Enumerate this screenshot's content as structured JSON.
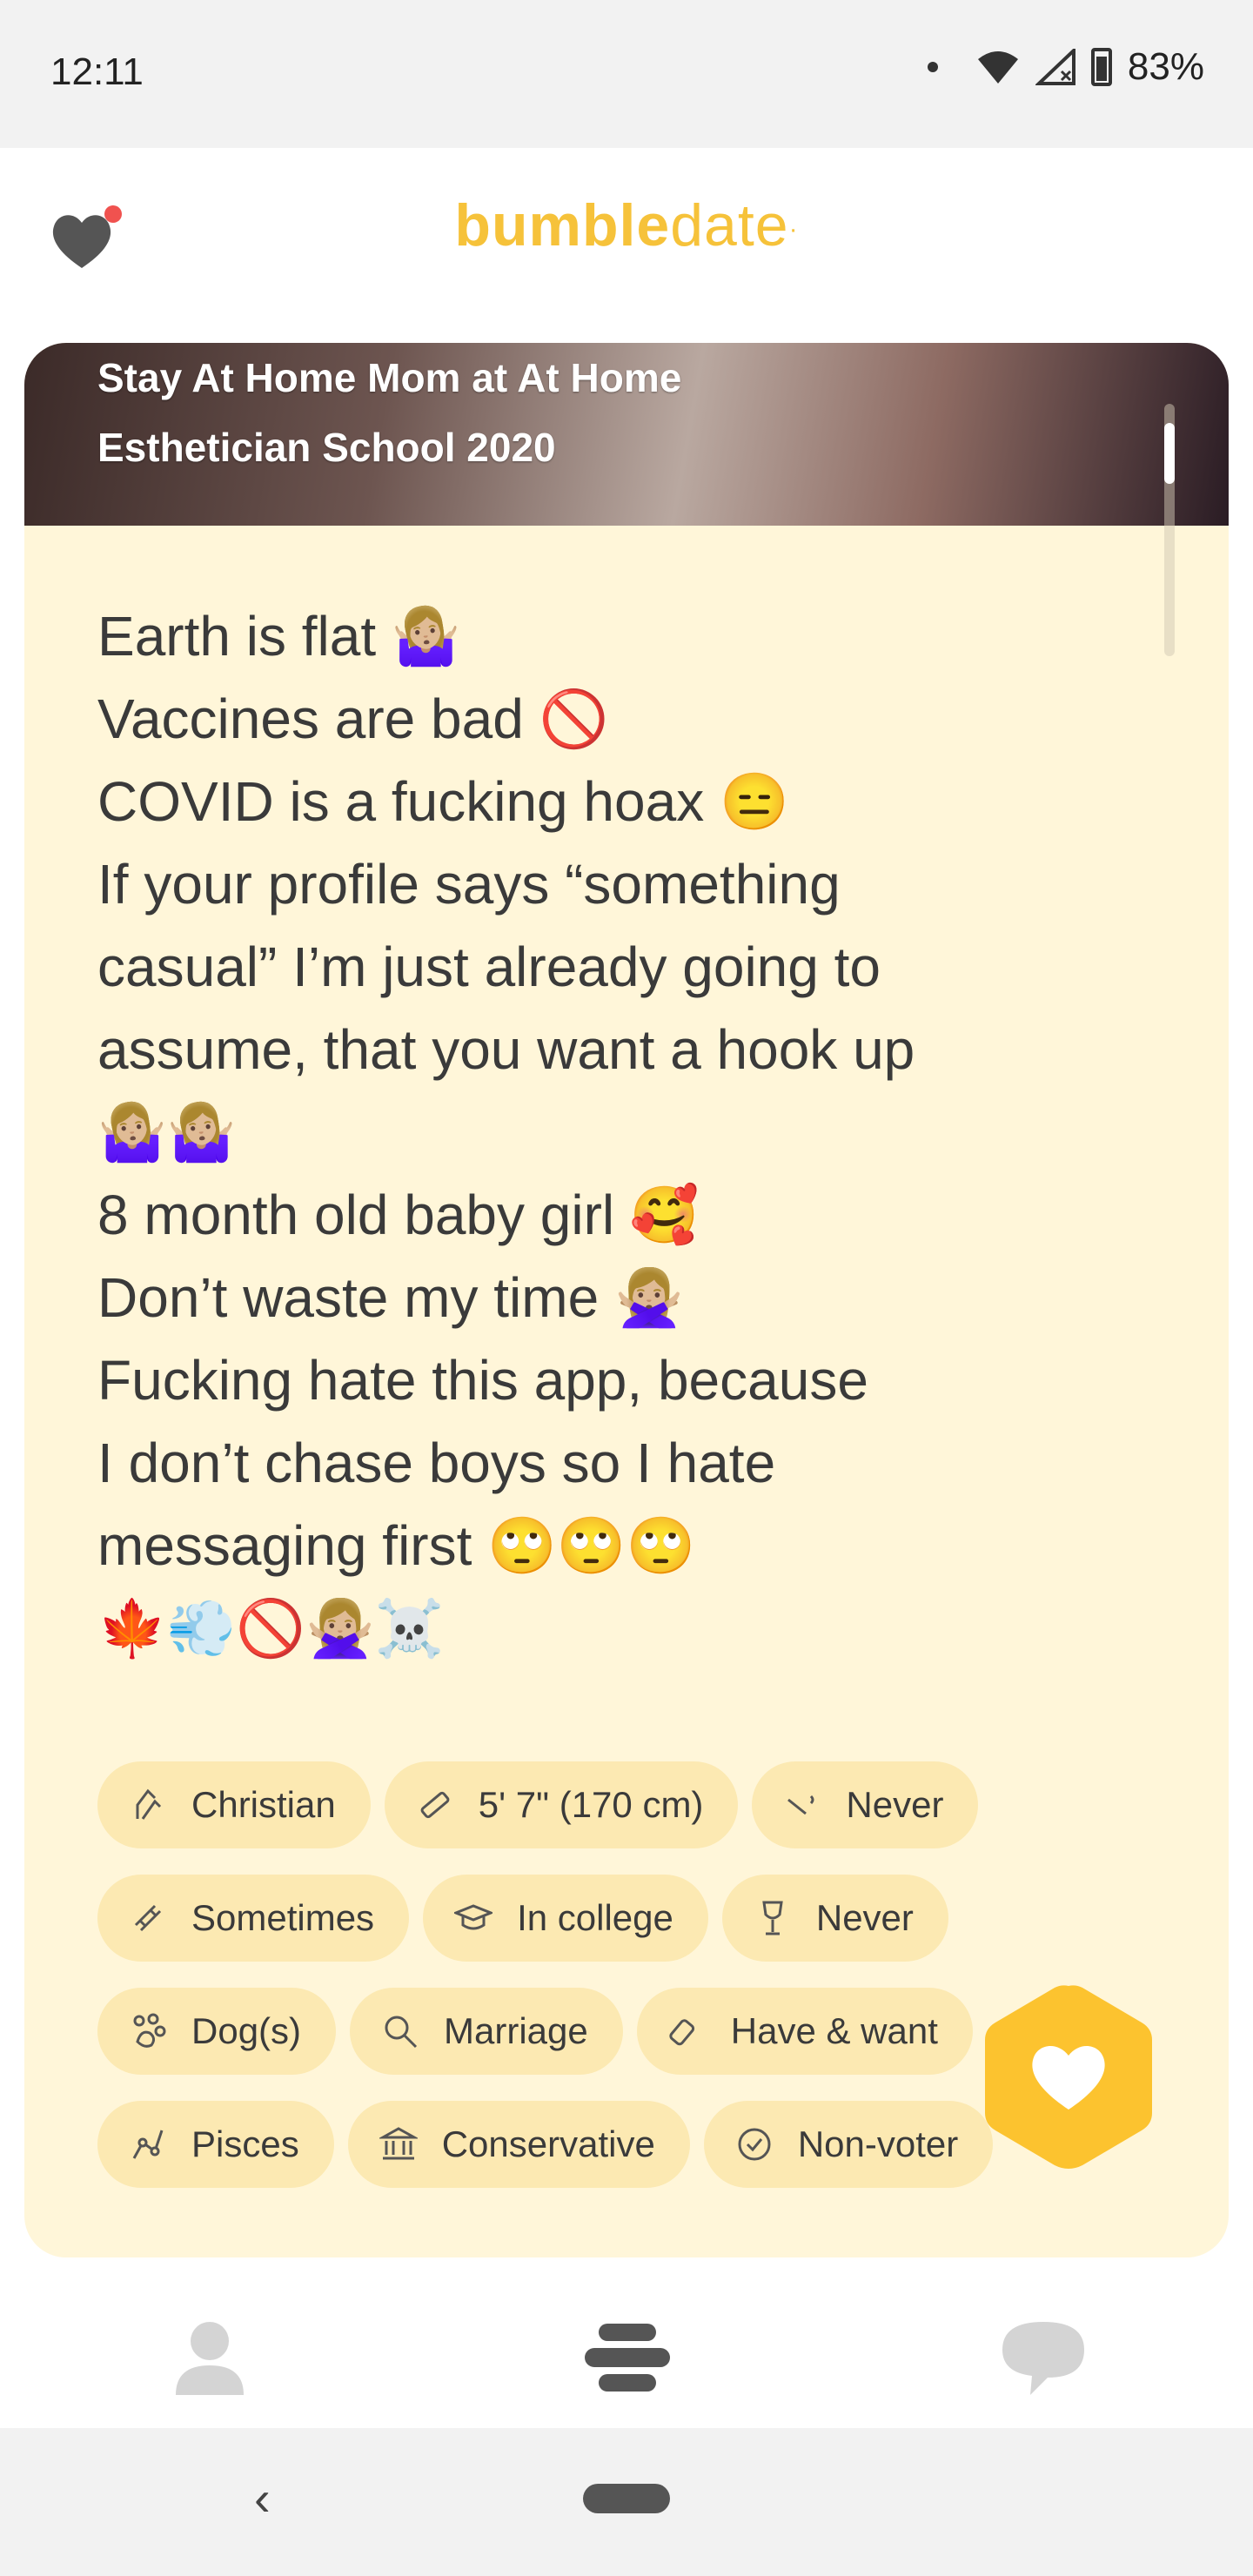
{
  "status_bar": {
    "time": "12:11",
    "battery": "83%"
  },
  "header": {
    "logo_bold": "bumble",
    "logo_light": "date"
  },
  "profile": {
    "photo_lines": [
      "Stay At Home Mom at At Home",
      "Esthetician School 2020"
    ],
    "bio_lines": [
      "Earth is flat 🤷🏼‍♀️",
      "Vaccines are bad 🚫",
      "COVID is a fucking hoax 😑",
      "If your profile says “something",
      "casual” I’m just already going to",
      "assume, that you want a hook up",
      "🤷🏼‍♀️🤷🏼‍♀️",
      "8 month old baby girl 🥰",
      "Don’t waste my time 🙅🏼‍♀️",
      "Fucking hate this app, because",
      "I don’t chase boys so I hate",
      "messaging first 🙄🙄🙄",
      "🍁💨🚫🙅🏼‍♀️☠️"
    ],
    "chips": [
      {
        "icon": "praying-hands-icon",
        "label": "Christian"
      },
      {
        "icon": "ruler-icon",
        "label": "5' 7\" (170 cm)"
      },
      {
        "icon": "smoking-icon",
        "label": "Never"
      },
      {
        "icon": "dumbbell-icon",
        "label": "Sometimes"
      },
      {
        "icon": "graduation-cap-icon",
        "label": "In college"
      },
      {
        "icon": "wine-glass-icon",
        "label": "Never"
      },
      {
        "icon": "paw-icon",
        "label": "Dog(s)"
      },
      {
        "icon": "search-icon",
        "label": "Marriage"
      },
      {
        "icon": "baby-bottle-icon",
        "label": "Have & want"
      },
      {
        "icon": "constellation-icon",
        "label": "Pisces"
      },
      {
        "icon": "government-icon",
        "label": "Conservative"
      },
      {
        "icon": "check-badge-icon",
        "label": "Non-voter"
      }
    ]
  },
  "colors": {
    "accent": "#f6c23a",
    "card_bg": "#fff6d9",
    "chip_bg": "#fce9b2"
  }
}
